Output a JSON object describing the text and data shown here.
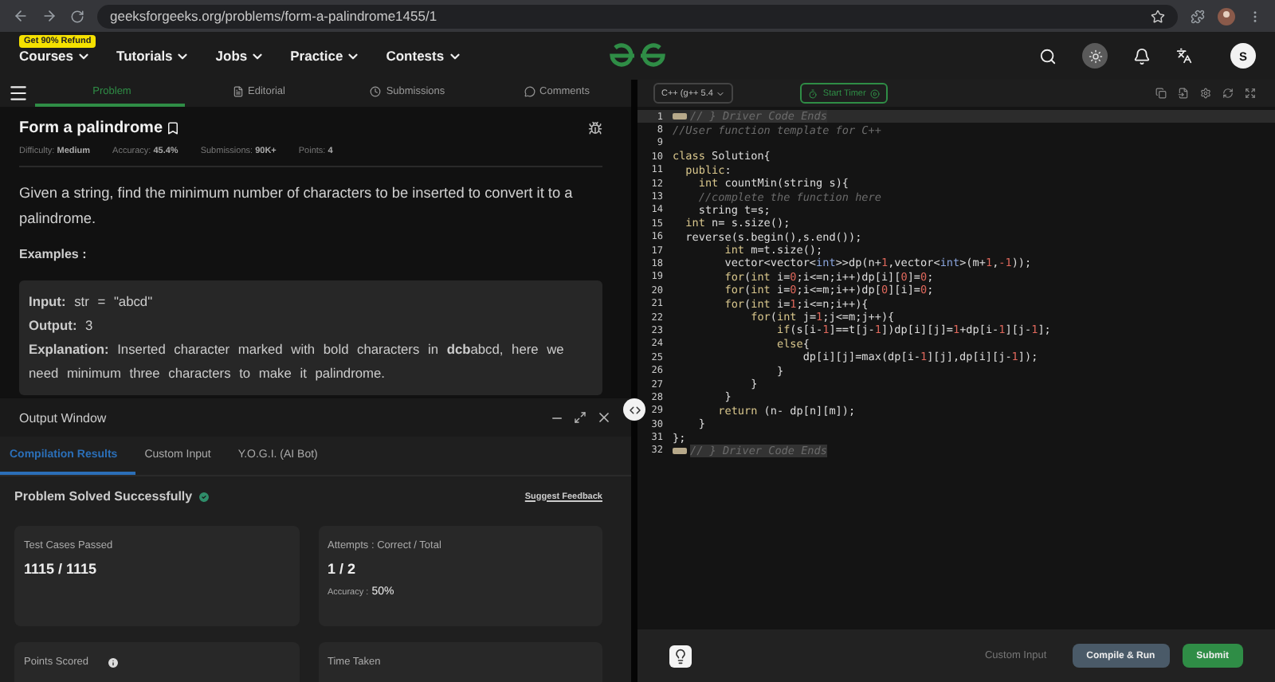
{
  "browser": {
    "url": "geeksforgeeks.org/problems/form-a-palindrome1455/1"
  },
  "nav": {
    "promo_badge": "Get 90% Refund",
    "items": [
      {
        "label": "Courses"
      },
      {
        "label": "Tutorials"
      },
      {
        "label": "Jobs"
      },
      {
        "label": "Practice"
      },
      {
        "label": "Contests"
      }
    ],
    "avatar": "S"
  },
  "problem_tabs": [
    {
      "label": "Problem",
      "selected": true
    },
    {
      "label": "Editorial",
      "selected": false
    },
    {
      "label": "Submissions",
      "selected": false
    },
    {
      "label": "Comments",
      "selected": false
    }
  ],
  "problem": {
    "title": "Form a palindrome",
    "meta": [
      "Difficulty: **Medium**",
      "Accuracy: **45.4%**",
      "Submissions: **90K+**",
      "Points: **4**"
    ],
    "description": "Given a string, find the minimum number of characters to be inserted to convert it to a palindrome.",
    "examples_heading": "Examples :",
    "example": [
      "**Input:** str = \"abcd\"",
      "**Output:** 3",
      "**Explanation:** Inserted character marked with bold characters in **dcb**abcd, here we need minimum three characters to make it palindrome."
    ]
  },
  "output_window": {
    "title": "Output Window",
    "tabs": [
      {
        "label": "Compilation Results",
        "selected": true
      },
      {
        "label": "Custom Input",
        "selected": false
      },
      {
        "label": "Y.O.G.I. (AI Bot)",
        "selected": false
      }
    ],
    "status": "Problem Solved Successfully",
    "feedback_link": "Suggest Feedback",
    "cards": [
      {
        "label": "Test Cases Passed",
        "value": "1115 / 1115",
        "info_icon": false
      },
      {
        "label": "Attempts : Correct / Total",
        "value": "1 / 2",
        "note_label": "Accuracy :",
        "note_value": "50%",
        "info_icon": false
      },
      {
        "label": "Points Scored",
        "info_icon": true
      },
      {
        "label": "Time Taken",
        "info_icon": false
      }
    ]
  },
  "editor": {
    "language": "C++ (g++ 5.4",
    "timer_button": "Start Timer",
    "lines": [
      {
        "number": "1",
        "active": true,
        "folded": true,
        "tokens": [
          {
            "text": "// } Driver Code Ends",
            "kind": "comment"
          }
        ]
      },
      {
        "number": "8",
        "active": false,
        "folded": false,
        "tokens": [
          {
            "text": "//User function template for C++",
            "kind": "comment"
          }
        ]
      },
      {
        "number": "9",
        "active": false,
        "folded": false
      },
      {
        "number": "10",
        "active": false,
        "folded": false,
        "tokens": [
          {
            "text": "class",
            "kind": "keyword"
          },
          {
            "text": " Solution{",
            "kind": "plain"
          }
        ]
      },
      {
        "number": "11",
        "active": false,
        "folded": false,
        "tokens": [
          {
            "text": "  public",
            "kind": "keyword"
          },
          {
            "text": ":",
            "kind": "plain"
          }
        ]
      },
      {
        "number": "12",
        "active": false,
        "folded": false,
        "tokens": [
          {
            "text": "    int",
            "kind": "keyword"
          },
          {
            "text": " countMin(string s){",
            "kind": "plain"
          }
        ]
      },
      {
        "number": "13",
        "active": false,
        "folded": false,
        "tokens": [
          {
            "text": "    //complete the function here",
            "kind": "comment"
          }
        ]
      },
      {
        "number": "14",
        "active": false,
        "folded": false,
        "tokens": [
          {
            "text": "    string t=s;",
            "kind": "plain"
          }
        ]
      },
      {
        "number": "15",
        "active": false,
        "folded": false,
        "tokens": [
          {
            "text": "  int",
            "kind": "keyword"
          },
          {
            "text": " n= s.size();",
            "kind": "plain"
          }
        ]
      },
      {
        "number": "16",
        "active": false,
        "folded": false,
        "tokens": [
          {
            "text": "  reverse(s.begin(),s.end());",
            "kind": "plain"
          }
        ]
      },
      {
        "number": "17",
        "active": false,
        "folded": false,
        "tokens": [
          {
            "text": "        int",
            "kind": "keyword"
          },
          {
            "text": " m=t.size();",
            "kind": "plain"
          }
        ]
      },
      {
        "number": "18",
        "active": false,
        "folded": false,
        "tokens": [
          {
            "text": "        vector<vector<",
            "kind": "plain"
          },
          {
            "text": "int",
            "kind": "type"
          },
          {
            "text": ">>dp(n+",
            "kind": "plain"
          },
          {
            "text": "1",
            "kind": "number"
          },
          {
            "text": ",vector<",
            "kind": "plain"
          },
          {
            "text": "int",
            "kind": "type"
          },
          {
            "text": ">(m+",
            "kind": "plain"
          },
          {
            "text": "1",
            "kind": "number"
          },
          {
            "text": ",",
            "kind": "plain"
          },
          {
            "text": "-1",
            "kind": "number"
          },
          {
            "text": "));",
            "kind": "plain"
          }
        ]
      },
      {
        "number": "19",
        "active": false,
        "folded": false,
        "tokens": [
          {
            "text": "        for",
            "kind": "keyword"
          },
          {
            "text": "(",
            "kind": "plain"
          },
          {
            "text": "int",
            "kind": "keyword"
          },
          {
            "text": " i=",
            "kind": "plain"
          },
          {
            "text": "0",
            "kind": "number"
          },
          {
            "text": ";i<=n;i++)dp[i][",
            "kind": "plain"
          },
          {
            "text": "0",
            "kind": "number"
          },
          {
            "text": "]=",
            "kind": "plain"
          },
          {
            "text": "0",
            "kind": "number"
          },
          {
            "text": ";",
            "kind": "plain"
          }
        ]
      },
      {
        "number": "20",
        "active": false,
        "folded": false,
        "tokens": [
          {
            "text": "        for",
            "kind": "keyword"
          },
          {
            "text": "(",
            "kind": "plain"
          },
          {
            "text": "int",
            "kind": "keyword"
          },
          {
            "text": " i=",
            "kind": "plain"
          },
          {
            "text": "0",
            "kind": "number"
          },
          {
            "text": ";i<=m;i++)dp[",
            "kind": "plain"
          },
          {
            "text": "0",
            "kind": "number"
          },
          {
            "text": "][i]=",
            "kind": "plain"
          },
          {
            "text": "0",
            "kind": "number"
          },
          {
            "text": ";",
            "kind": "plain"
          }
        ]
      },
      {
        "number": "21",
        "active": false,
        "folded": false,
        "tokens": [
          {
            "text": "        for",
            "kind": "keyword"
          },
          {
            "text": "(",
            "kind": "plain"
          },
          {
            "text": "int",
            "kind": "keyword"
          },
          {
            "text": " i=",
            "kind": "plain"
          },
          {
            "text": "1",
            "kind": "number"
          },
          {
            "text": ";i<=n;i++){",
            "kind": "plain"
          }
        ]
      },
      {
        "number": "22",
        "active": false,
        "folded": false,
        "tokens": [
          {
            "text": "            for",
            "kind": "keyword"
          },
          {
            "text": "(",
            "kind": "plain"
          },
          {
            "text": "int",
            "kind": "keyword"
          },
          {
            "text": " j=",
            "kind": "plain"
          },
          {
            "text": "1",
            "kind": "number"
          },
          {
            "text": ";j<=m;j++){",
            "kind": "plain"
          }
        ]
      },
      {
        "number": "23",
        "active": false,
        "folded": false,
        "tokens": [
          {
            "text": "                if",
            "kind": "keyword"
          },
          {
            "text": "(s[i-",
            "kind": "plain"
          },
          {
            "text": "1",
            "kind": "number"
          },
          {
            "text": "]==t[j-",
            "kind": "plain"
          },
          {
            "text": "1",
            "kind": "number"
          },
          {
            "text": "])dp[i][j]=",
            "kind": "plain"
          },
          {
            "text": "1",
            "kind": "number"
          },
          {
            "text": "+dp[i-",
            "kind": "plain"
          },
          {
            "text": "1",
            "kind": "number"
          },
          {
            "text": "][j-",
            "kind": "plain"
          },
          {
            "text": "1",
            "kind": "number"
          },
          {
            "text": "];",
            "kind": "plain"
          }
        ]
      },
      {
        "number": "24",
        "active": false,
        "folded": false,
        "tokens": [
          {
            "text": "                else",
            "kind": "keyword"
          },
          {
            "text": "{",
            "kind": "plain"
          }
        ]
      },
      {
        "number": "25",
        "active": false,
        "folded": false,
        "tokens": [
          {
            "text": "                    dp[i][j]=max(dp[i-",
            "kind": "plain"
          },
          {
            "text": "1",
            "kind": "number"
          },
          {
            "text": "][j],dp[i][j-",
            "kind": "plain"
          },
          {
            "text": "1",
            "kind": "number"
          },
          {
            "text": "]);",
            "kind": "plain"
          }
        ]
      },
      {
        "number": "26",
        "active": false,
        "folded": false,
        "tokens": [
          {
            "text": "                }",
            "kind": "plain"
          }
        ]
      },
      {
        "number": "27",
        "active": false,
        "folded": false,
        "tokens": [
          {
            "text": "            }",
            "kind": "plain"
          }
        ]
      },
      {
        "number": "28",
        "active": false,
        "folded": false,
        "tokens": [
          {
            "text": "        }",
            "kind": "plain"
          }
        ]
      },
      {
        "number": "29",
        "active": false,
        "folded": false,
        "tokens": [
          {
            "text": "       return",
            "kind": "keyword"
          },
          {
            "text": " (n- dp[n][m]);",
            "kind": "plain"
          }
        ]
      },
      {
        "number": "30",
        "active": false,
        "folded": false,
        "tokens": [
          {
            "text": "    }",
            "kind": "plain"
          }
        ]
      },
      {
        "number": "31",
        "active": false,
        "folded": false,
        "tokens": [
          {
            "text": "};",
            "kind": "plain"
          }
        ]
      },
      {
        "number": "32",
        "active": false,
        "folded": true,
        "tokens": [
          {
            "text": "// } Driver Code Ends",
            "kind": "comment"
          }
        ]
      }
    ]
  },
  "footer": {
    "custom_input": "Custom Input",
    "compile_button": "Compile & Run",
    "submit_button": "Submit"
  }
}
